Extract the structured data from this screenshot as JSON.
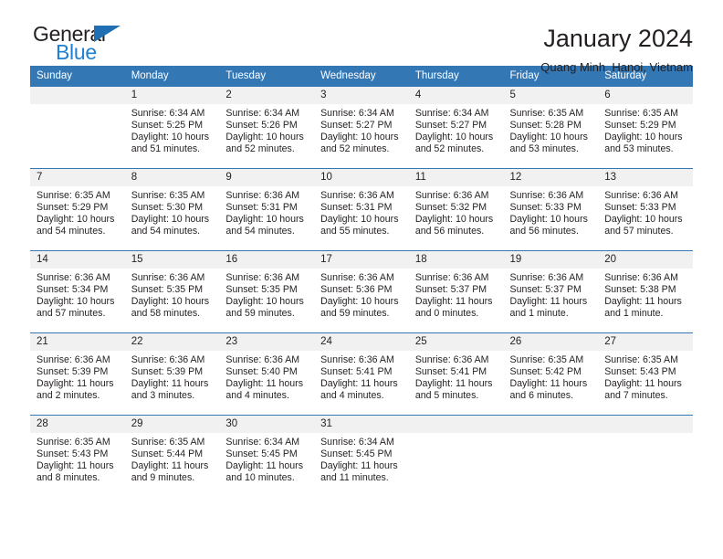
{
  "brand": {
    "name_top": "General",
    "name_bottom": "Blue",
    "triangle_color": "#1f6fb2",
    "blue_color": "#1f7fd4"
  },
  "header": {
    "title": "January 2024",
    "subtitle": "Quang Minh, Hanoi, Vietnam"
  },
  "theme": {
    "header_blue": "#3477b5",
    "daynum_band": "#f1f1f1",
    "text": "#231f20"
  },
  "calendar": {
    "weekday_headers": [
      "Sunday",
      "Monday",
      "Tuesday",
      "Wednesday",
      "Thursday",
      "Friday",
      "Saturday"
    ],
    "labels": {
      "sunrise": "Sunrise:",
      "sunset": "Sunset:",
      "daylight": "Daylight:"
    },
    "weeks": [
      [
        {
          "day": "",
          "sunrise": "",
          "sunset": "",
          "daylight": ""
        },
        {
          "day": "1",
          "sunrise": "Sunrise: 6:34 AM",
          "sunset": "Sunset: 5:25 PM",
          "daylight": "Daylight: 10 hours and 51 minutes."
        },
        {
          "day": "2",
          "sunrise": "Sunrise: 6:34 AM",
          "sunset": "Sunset: 5:26 PM",
          "daylight": "Daylight: 10 hours and 52 minutes."
        },
        {
          "day": "3",
          "sunrise": "Sunrise: 6:34 AM",
          "sunset": "Sunset: 5:27 PM",
          "daylight": "Daylight: 10 hours and 52 minutes."
        },
        {
          "day": "4",
          "sunrise": "Sunrise: 6:34 AM",
          "sunset": "Sunset: 5:27 PM",
          "daylight": "Daylight: 10 hours and 52 minutes."
        },
        {
          "day": "5",
          "sunrise": "Sunrise: 6:35 AM",
          "sunset": "Sunset: 5:28 PM",
          "daylight": "Daylight: 10 hours and 53 minutes."
        },
        {
          "day": "6",
          "sunrise": "Sunrise: 6:35 AM",
          "sunset": "Sunset: 5:29 PM",
          "daylight": "Daylight: 10 hours and 53 minutes."
        }
      ],
      [
        {
          "day": "7",
          "sunrise": "Sunrise: 6:35 AM",
          "sunset": "Sunset: 5:29 PM",
          "daylight": "Daylight: 10 hours and 54 minutes."
        },
        {
          "day": "8",
          "sunrise": "Sunrise: 6:35 AM",
          "sunset": "Sunset: 5:30 PM",
          "daylight": "Daylight: 10 hours and 54 minutes."
        },
        {
          "day": "9",
          "sunrise": "Sunrise: 6:36 AM",
          "sunset": "Sunset: 5:31 PM",
          "daylight": "Daylight: 10 hours and 54 minutes."
        },
        {
          "day": "10",
          "sunrise": "Sunrise: 6:36 AM",
          "sunset": "Sunset: 5:31 PM",
          "daylight": "Daylight: 10 hours and 55 minutes."
        },
        {
          "day": "11",
          "sunrise": "Sunrise: 6:36 AM",
          "sunset": "Sunset: 5:32 PM",
          "daylight": "Daylight: 10 hours and 56 minutes."
        },
        {
          "day": "12",
          "sunrise": "Sunrise: 6:36 AM",
          "sunset": "Sunset: 5:33 PM",
          "daylight": "Daylight: 10 hours and 56 minutes."
        },
        {
          "day": "13",
          "sunrise": "Sunrise: 6:36 AM",
          "sunset": "Sunset: 5:33 PM",
          "daylight": "Daylight: 10 hours and 57 minutes."
        }
      ],
      [
        {
          "day": "14",
          "sunrise": "Sunrise: 6:36 AM",
          "sunset": "Sunset: 5:34 PM",
          "daylight": "Daylight: 10 hours and 57 minutes."
        },
        {
          "day": "15",
          "sunrise": "Sunrise: 6:36 AM",
          "sunset": "Sunset: 5:35 PM",
          "daylight": "Daylight: 10 hours and 58 minutes."
        },
        {
          "day": "16",
          "sunrise": "Sunrise: 6:36 AM",
          "sunset": "Sunset: 5:35 PM",
          "daylight": "Daylight: 10 hours and 59 minutes."
        },
        {
          "day": "17",
          "sunrise": "Sunrise: 6:36 AM",
          "sunset": "Sunset: 5:36 PM",
          "daylight": "Daylight: 10 hours and 59 minutes."
        },
        {
          "day": "18",
          "sunrise": "Sunrise: 6:36 AM",
          "sunset": "Sunset: 5:37 PM",
          "daylight": "Daylight: 11 hours and 0 minutes."
        },
        {
          "day": "19",
          "sunrise": "Sunrise: 6:36 AM",
          "sunset": "Sunset: 5:37 PM",
          "daylight": "Daylight: 11 hours and 1 minute."
        },
        {
          "day": "20",
          "sunrise": "Sunrise: 6:36 AM",
          "sunset": "Sunset: 5:38 PM",
          "daylight": "Daylight: 11 hours and 1 minute."
        }
      ],
      [
        {
          "day": "21",
          "sunrise": "Sunrise: 6:36 AM",
          "sunset": "Sunset: 5:39 PM",
          "daylight": "Daylight: 11 hours and 2 minutes."
        },
        {
          "day": "22",
          "sunrise": "Sunrise: 6:36 AM",
          "sunset": "Sunset: 5:39 PM",
          "daylight": "Daylight: 11 hours and 3 minutes."
        },
        {
          "day": "23",
          "sunrise": "Sunrise: 6:36 AM",
          "sunset": "Sunset: 5:40 PM",
          "daylight": "Daylight: 11 hours and 4 minutes."
        },
        {
          "day": "24",
          "sunrise": "Sunrise: 6:36 AM",
          "sunset": "Sunset: 5:41 PM",
          "daylight": "Daylight: 11 hours and 4 minutes."
        },
        {
          "day": "25",
          "sunrise": "Sunrise: 6:36 AM",
          "sunset": "Sunset: 5:41 PM",
          "daylight": "Daylight: 11 hours and 5 minutes."
        },
        {
          "day": "26",
          "sunrise": "Sunrise: 6:35 AM",
          "sunset": "Sunset: 5:42 PM",
          "daylight": "Daylight: 11 hours and 6 minutes."
        },
        {
          "day": "27",
          "sunrise": "Sunrise: 6:35 AM",
          "sunset": "Sunset: 5:43 PM",
          "daylight": "Daylight: 11 hours and 7 minutes."
        }
      ],
      [
        {
          "day": "28",
          "sunrise": "Sunrise: 6:35 AM",
          "sunset": "Sunset: 5:43 PM",
          "daylight": "Daylight: 11 hours and 8 minutes."
        },
        {
          "day": "29",
          "sunrise": "Sunrise: 6:35 AM",
          "sunset": "Sunset: 5:44 PM",
          "daylight": "Daylight: 11 hours and 9 minutes."
        },
        {
          "day": "30",
          "sunrise": "Sunrise: 6:34 AM",
          "sunset": "Sunset: 5:45 PM",
          "daylight": "Daylight: 11 hours and 10 minutes."
        },
        {
          "day": "31",
          "sunrise": "Sunrise: 6:34 AM",
          "sunset": "Sunset: 5:45 PM",
          "daylight": "Daylight: 11 hours and 11 minutes."
        },
        {
          "day": "",
          "sunrise": "",
          "sunset": "",
          "daylight": ""
        },
        {
          "day": "",
          "sunrise": "",
          "sunset": "",
          "daylight": ""
        },
        {
          "day": "",
          "sunrise": "",
          "sunset": "",
          "daylight": ""
        }
      ]
    ]
  }
}
